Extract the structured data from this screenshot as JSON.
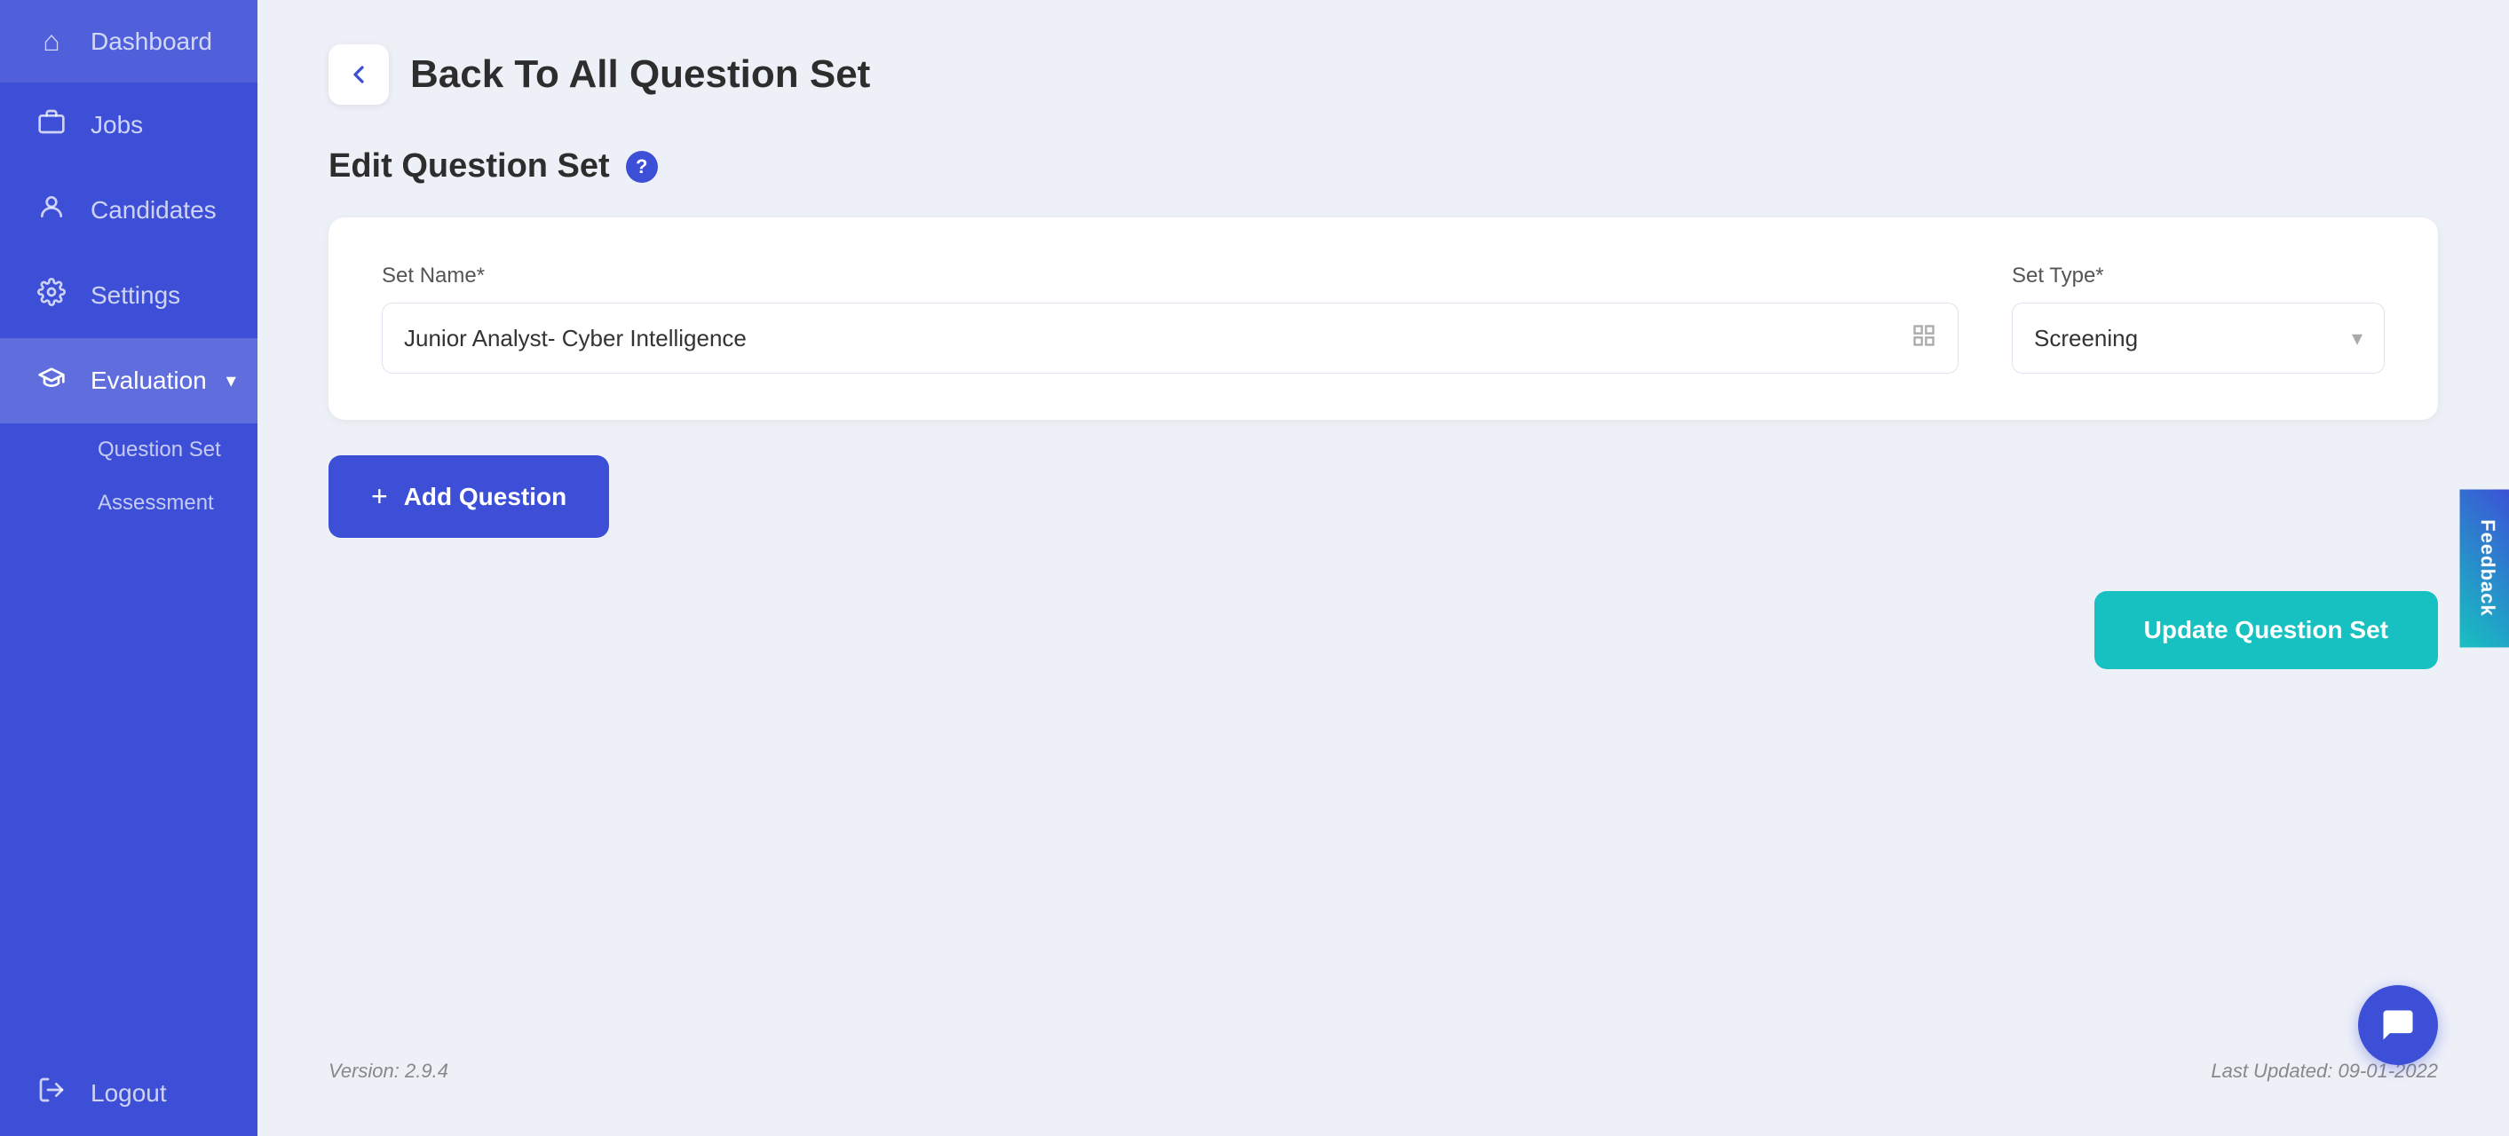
{
  "sidebar": {
    "items": [
      {
        "id": "dashboard",
        "label": "Dashboard",
        "icon": "⌂",
        "active": false
      },
      {
        "id": "jobs",
        "label": "Jobs",
        "icon": "💼",
        "active": false
      },
      {
        "id": "candidates",
        "label": "Candidates",
        "icon": "👤",
        "active": false
      },
      {
        "id": "settings",
        "label": "Settings",
        "icon": "⚙",
        "active": false
      },
      {
        "id": "evaluation",
        "label": "Evaluation",
        "icon": "🎓",
        "active": true
      }
    ],
    "evaluation_sub_items": [
      {
        "id": "question-set",
        "label": "Question Set"
      },
      {
        "id": "assessment",
        "label": "Assessment"
      }
    ],
    "logout_label": "Logout",
    "logout_icon": "↪"
  },
  "header": {
    "back_label": "Back To All Question Set"
  },
  "page": {
    "title": "Edit Question Set",
    "help_icon": "?"
  },
  "form": {
    "set_name_label": "Set Name*",
    "set_name_value": "Junior Analyst- Cyber Intelligence",
    "set_type_label": "Set Type*",
    "set_type_value": "Screening"
  },
  "buttons": {
    "add_question": "+ Add Question",
    "update": "Update Question Set"
  },
  "footer": {
    "version": "Version: 2.9.4",
    "last_updated": "Last Updated: 09-01-2022"
  },
  "feedback_tab": "Feedback",
  "chat_icon": "chat"
}
